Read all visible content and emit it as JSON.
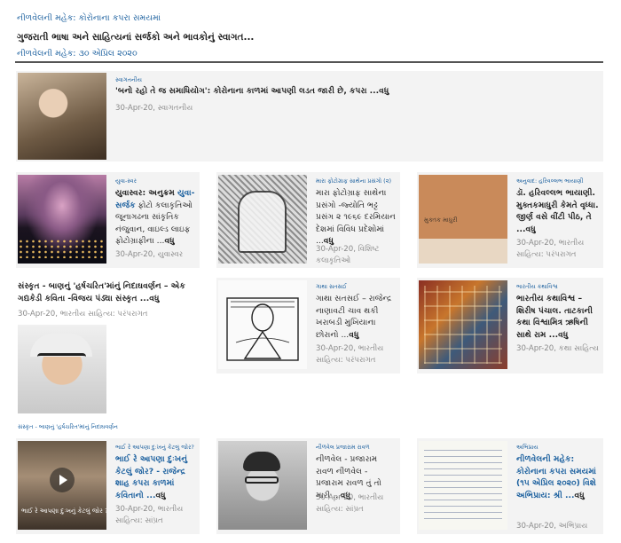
{
  "header": {
    "site_title": "નીળવેલની મહેક: કોરોનાના કપરા સમયમાં",
    "tagline": "ગુજરાતી ભાષા અને સાહિત્યનાં સર્જકો અને ભાવકોનું સ્વાગત...",
    "subtitle": "નીળવેલની મહેક: ૩૦ એપ્રિલ ૨૦૨૦"
  },
  "featured": {
    "category": "સ્વાગતનીય",
    "title": "'બનો રહો તે જ સમાધિયોગ': કોરોનાના કાળમાં  આપણી લડત જારી છે, કપરા ...",
    "more": "વધુ",
    "meta": "30-Apr-20, સ્વાગતનીય"
  },
  "cards": [
    {
      "category": "યુવા-સ્વર",
      "title": "યુવાસ્વર: અનુક્રમ ",
      "title_blue": "યુવા-સર્જક",
      "title_rest": " ફોટો કલાકૃતિઓ જૂનાગઢના સાંકૃતિક નંજુવાન, વાઇલ્ડ લાઇફ ફોટોગ્રાફીના ...",
      "more": "વધુ",
      "meta": "30-Apr-20, યુવાસ્વર"
    },
    {
      "category": "મારા ફોટોગ્રાફ સાથેના પ્રસંગો (૨)",
      "title": "મારા ફોટોગ્રાફ સાથેના પ્રસંગો -જ્યોતિ ભટ્ટ પ્રસંગ ૨ ૧૯૬૯ દરમિયાન દેશમાં વિવિધ પ્રદેશોમાં ...",
      "more": "વધુ",
      "meta": "30-Apr-20, વિશિષ્ટ કલાકૃતિઓ"
    },
    {
      "category": "અનુવાદ: હરિવલ્લભ ભાયાણી",
      "title": "ડૉ. હરિવલ્લભ ભાયાણી. મુક્તકમાધુરી કેમતે વૃધ્ધા. જીર્ણ વસે વીંટી પીઠ, તે ...",
      "more": "વધુ",
      "meta": "30-Apr-20, ભારતીય સાહિત્ય: પરંપરાગત",
      "book_label": "મુક્તક માધુરી"
    },
    {
      "category": "ગાથા સતસઈ",
      "title": "ગાથા સતસઈ – રાજેન્દ્ર નાણાવટી ચાવ થકી ખરાબડી મુખિયાના છોરાનો ...",
      "more": "વધુ",
      "meta": "30-Apr-20, ભારતીય સાહિત્ય: પરંપરાગત"
    },
    {
      "category": "ભારતીય કથાવિશ્વ",
      "title": "ભારતીય કથાવિશ્વ – શિરીષ પંચાલ. તાટકાની કથા વિશ્વામિત્ર ઋષિની સાથે રામ ...",
      "more": "વધુ",
      "meta": "30-Apr-20, કથા સાહિત્ય"
    },
    {
      "category": "ભાઈ રે આપણા દુઃખનું કેટલું જોર?",
      "title": "ભાઈ રે આપણા દુઃખનું કેટલું જોર? - રાજેન્દ્ર શાહ કપરા કાળમાં કવિતાનો ...",
      "more": "વધુ",
      "meta": "30-Apr-20, ભારતીય સાહિત્ય: સાંપ્રત",
      "video_caption": "ભાઈ રે આપણા દુઃખનું કેટલું જોર ?"
    },
    {
      "category": "નીળવેલ પ્રજારામ રાવળ",
      "title": "નીળવેલ - પ્રજારામ રાવળ નીળવેલ - પ્રજારામ રાવળ તું તો મારી ...",
      "more": "વધુ",
      "meta": "30-Apr-20, ભારતીય સાહિત્ય: સાંપ્રત"
    },
    {
      "category": "અભિપ્રાય",
      "title": "નીળવેલની મહેક: કોરોનાના કપરા સમયમાં (૧૫ એપ્રિલ ૨૦૨૦) વિશે અભિપ્રાય: શ્રી ...",
      "more": "વધુ",
      "meta": "30-Apr-20, અભિપ્રાય"
    }
  ],
  "text_article": {
    "title": "સંસ્કૃત - બાણનું 'હર્ષચરિત'માંનું નિદાઘવર્ણન – એક ગદ્યકેડી કવિતા -વિજય પંડ્યા સંસ્કૃત ...",
    "more": "વધુ",
    "meta": "30-Apr-20, ભારતીય સાહિત્ય: પરંપરાગત",
    "image_caption": "સંસ્કૃત - બાણનું 'હર્ષચરિત'માંનું નિદાઘવર્ણન"
  }
}
